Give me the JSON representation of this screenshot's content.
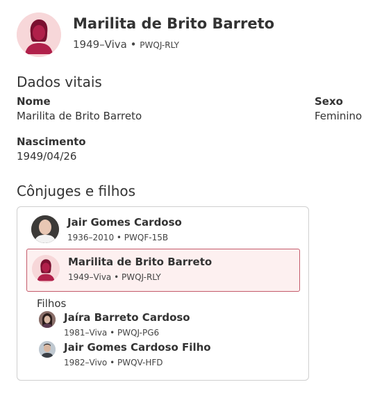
{
  "header": {
    "name": "Marilita de Brito Barreto",
    "lifespan": "1949–Viva",
    "separator": "•",
    "pid": "PWQJ-RLY"
  },
  "vitals": {
    "title": "Dados vitais",
    "name_label": "Nome",
    "name_value": "Marilita de Brito Barreto",
    "sex_label": "Sexo",
    "sex_value": "Feminino",
    "birth_label": "Nascimento",
    "birth_value": "1949/04/26"
  },
  "family": {
    "title": "Cônjuges e filhos",
    "spouse": {
      "name": "Jair Gomes Cardoso",
      "meta": "1936–2010 • PWQF-15B"
    },
    "self": {
      "name": "Marilita de Brito Barreto",
      "meta": "1949–Viva • PWQJ-RLY"
    },
    "children_label": "Filhos",
    "children": [
      {
        "name": "Jaíra Barreto Cardoso",
        "meta": "1981–Viva • PWQJ-PG6"
      },
      {
        "name": "Jair Gomes Cardoso Filho",
        "meta": "1982–Vivo • PWQV-HFD"
      }
    ]
  },
  "colors": {
    "female_avatar_bg": "#f7d7d9",
    "female_silhouette": "#b0204a",
    "highlight_bg": "#fdf0f0",
    "highlight_border": "#c45a6a"
  }
}
